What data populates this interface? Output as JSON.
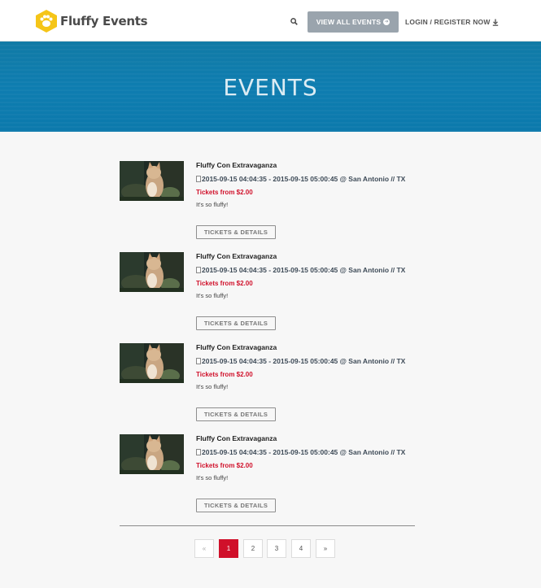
{
  "header": {
    "brand": "Fluffy Events",
    "view_all_label": "VIEW ALL EVENTS",
    "login_label": "LOGIN / REGISTER NOW"
  },
  "banner": {
    "title": "EVENTS"
  },
  "events": [
    {
      "title": "Fluffy Con Extravaganza",
      "datetime": "2015-09-15 04:04:35 - 2015-09-15 05:00:45 @ San Antonio // TX",
      "price": "Tickets from $2.00",
      "description": "It's so fluffy!",
      "button": "TICKETS & DETAILS"
    },
    {
      "title": "Fluffy Con Extravaganza",
      "datetime": "2015-09-15 04:04:35 - 2015-09-15 05:00:45 @ San Antonio // TX",
      "price": "Tickets from $2.00",
      "description": "It's so fluffy!",
      "button": "TICKETS & DETAILS"
    },
    {
      "title": "Fluffy Con Extravaganza",
      "datetime": "2015-09-15 04:04:35 - 2015-09-15 05:00:45 @ San Antonio // TX",
      "price": "Tickets from $2.00",
      "description": "It's so fluffy!",
      "button": "TICKETS & DETAILS"
    },
    {
      "title": "Fluffy Con Extravaganza",
      "datetime": "2015-09-15 04:04:35 - 2015-09-15 05:00:45 @ San Antonio // TX",
      "price": "Tickets from $2.00",
      "description": "It's so fluffy!",
      "button": "TICKETS & DETAILS"
    }
  ],
  "pagination": {
    "prev": "«",
    "pages": [
      "1",
      "2",
      "3",
      "4"
    ],
    "next": "»",
    "current": "1"
  },
  "colors": {
    "brand_yellow": "#f5c518",
    "banner_blue": "#0e7db0",
    "accent_red": "#d0102a",
    "button_gray": "#9aa4ad"
  },
  "icons": {
    "logo": "paw-hexagon-icon",
    "search": "search-icon",
    "view_all": "arrow-circle-right-icon",
    "login": "download-icon",
    "date": "document-icon"
  }
}
